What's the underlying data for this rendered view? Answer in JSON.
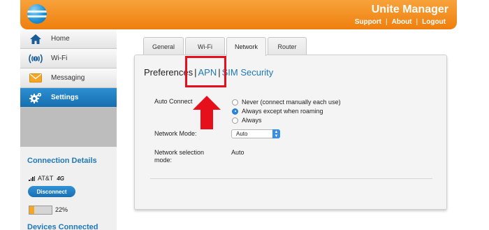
{
  "header": {
    "title": "Unite Manager",
    "links": {
      "support": "Support",
      "about": "About",
      "logout": "Logout"
    },
    "separator": "|",
    "logo_icon": "att-globe-icon",
    "color_top": "#f7a23a",
    "color_bottom": "#ef7f0d"
  },
  "sidebar": {
    "items": [
      {
        "label": "Home",
        "icon": "home-icon"
      },
      {
        "label": "Wi-Fi",
        "icon": "wifi-icon"
      },
      {
        "label": "Messaging",
        "icon": "envelope-icon"
      },
      {
        "label": "Settings",
        "icon": "gear-icon",
        "active": true
      }
    ],
    "connection": {
      "title": "Connection Details",
      "carrier": "AT&T",
      "network_type": "4G",
      "disconnect_label": "Disconnect",
      "battery_percent": "22%",
      "battery_level": 0.22
    },
    "devices_title": "Devices Connected"
  },
  "tabs": [
    {
      "label": "General"
    },
    {
      "label": "Wi-Fi"
    },
    {
      "label": "Network",
      "active": true
    },
    {
      "label": "Router"
    }
  ],
  "subnav": {
    "preferences": "Preferences",
    "apn": "APN",
    "sim_security": "SIM Security",
    "separator": "|"
  },
  "form": {
    "auto_connect": {
      "label": "Auto Connect",
      "options": [
        {
          "label": "Never (connect manually each use)",
          "checked": false
        },
        {
          "label": "Always except when roaming",
          "checked": true
        },
        {
          "label": "Always",
          "checked": false
        }
      ]
    },
    "network_mode": {
      "label": "Network Mode:",
      "value": "Auto"
    },
    "network_selection": {
      "label": "Network selection mode:",
      "value": "Auto"
    }
  },
  "colors": {
    "accent_blue": "#1f78b8",
    "annotation_red": "#e5101c",
    "battery_orange": "#f5a623"
  }
}
